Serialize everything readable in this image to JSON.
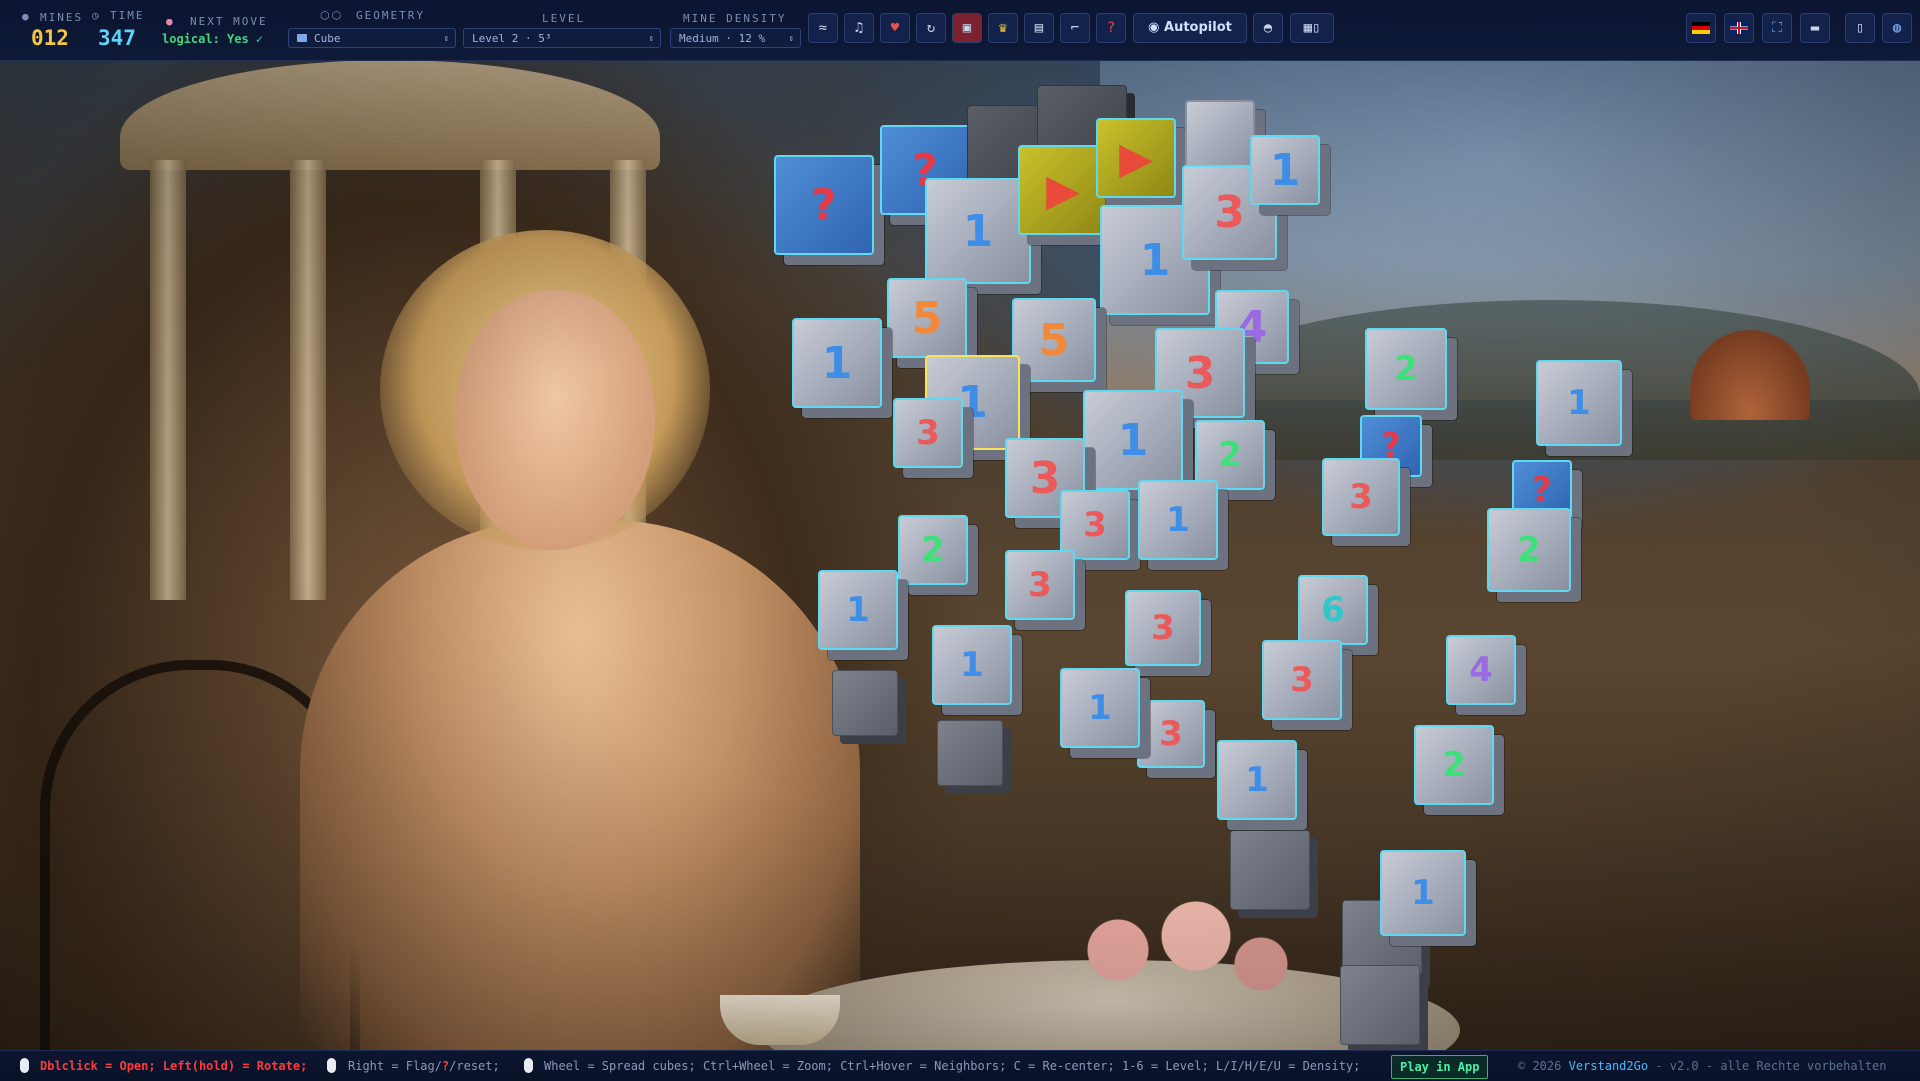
{
  "header": {
    "mines_label": "MINES",
    "time_label": "TIME",
    "mines_value": "012",
    "time_value": "347",
    "next_move_label": "NEXT MOVE",
    "next_move_value": "logical: Yes ✓",
    "geometry_label": "GEOMETRY",
    "geometry_value": "Cube",
    "level_label": "LEVEL",
    "level_value": "Level 2 · 5³",
    "density_label": "MINE DENSITY",
    "density_value": "Medium · 12 %",
    "autopilot_label": "Autopilot",
    "colors": {
      "mines": "#f4c542",
      "time": "#5ed3f5",
      "next_move": "#43d67a"
    }
  },
  "toolbar_icons": [
    "whale-icon",
    "music-icon",
    "shop-icon",
    "reload-icon",
    "card-icon",
    "trophy-icon",
    "save-icon",
    "load-icon",
    "help-icon",
    "camera-icon",
    "layout-icon"
  ],
  "right_icons": [
    "flag-de-icon",
    "flag-uk-icon",
    "fullscreen-icon",
    "theme-icon",
    "mobile-icon",
    "user-icon"
  ],
  "board": {
    "cubes": [
      {
        "v": "?",
        "k": "q"
      },
      {
        "v": "?",
        "k": "q"
      },
      {
        "v": "",
        "k": "dark"
      },
      {
        "v": "",
        "k": "dark"
      },
      {
        "v": "1",
        "k": "n1"
      },
      {
        "v": "▶",
        "k": "yellow"
      },
      {
        "v": "▶",
        "k": "yellow"
      },
      {
        "v": "",
        "k": "plain"
      },
      {
        "v": "1",
        "k": "n1"
      },
      {
        "v": "3",
        "k": "n3"
      },
      {
        "v": "1",
        "k": "n1"
      },
      {
        "v": "5",
        "k": "n5"
      },
      {
        "v": "5",
        "k": "n5"
      },
      {
        "v": "1",
        "k": "n1"
      },
      {
        "v": "1",
        "k": "n1"
      },
      {
        "v": "3",
        "k": "n3"
      },
      {
        "v": "4",
        "k": "n4"
      },
      {
        "v": "3",
        "k": "n3"
      },
      {
        "v": "1",
        "k": "n1"
      },
      {
        "v": "2",
        "k": "n2"
      },
      {
        "v": "3",
        "k": "n3"
      },
      {
        "v": "3",
        "k": "n3"
      },
      {
        "v": "1",
        "k": "n1"
      },
      {
        "v": "2",
        "k": "n2"
      },
      {
        "v": "1",
        "k": "n1"
      },
      {
        "v": "3",
        "k": "n3"
      },
      {
        "v": "1",
        "k": "n1"
      },
      {
        "v": "3",
        "k": "n3"
      },
      {
        "v": "3",
        "k": "n3"
      },
      {
        "v": "1",
        "k": "n1"
      },
      {
        "v": "",
        "k": "closed"
      },
      {
        "v": "",
        "k": "closed"
      },
      {
        "v": "",
        "k": "closed"
      },
      {
        "v": "2",
        "k": "n2"
      },
      {
        "v": "?",
        "k": "q"
      },
      {
        "v": "3",
        "k": "n3"
      },
      {
        "v": "6",
        "k": "n6"
      },
      {
        "v": "3",
        "k": "n3"
      },
      {
        "v": "1",
        "k": "n1"
      },
      {
        "v": "",
        "k": "closed"
      },
      {
        "v": "1",
        "k": "n1"
      },
      {
        "v": "?",
        "k": "q"
      },
      {
        "v": "2",
        "k": "n2"
      },
      {
        "v": "4",
        "k": "n4"
      },
      {
        "v": "2",
        "k": "n2"
      },
      {
        "v": "1",
        "k": "n1"
      },
      {
        "v": "",
        "k": "closed"
      }
    ]
  },
  "footer": {
    "hint_open": "Dblclick = Open; Left(hold) = Rotate;",
    "hint_flag_a": "Right = Flag/",
    "hint_flag_q": "?",
    "hint_flag_b": "/reset;",
    "hint_wheel": "Wheel = Spread cubes; Ctrl+Wheel = Zoom; Ctrl+Hover = Neighbors; C = Re-center; 1-6 = Level; L/I/H/E/U = Density;",
    "play_label": "Play in App",
    "copyright": "© 2026",
    "brand": "Verstand2Go",
    "version_rights": "- v2.0 - alle Rechte vorbehalten"
  }
}
